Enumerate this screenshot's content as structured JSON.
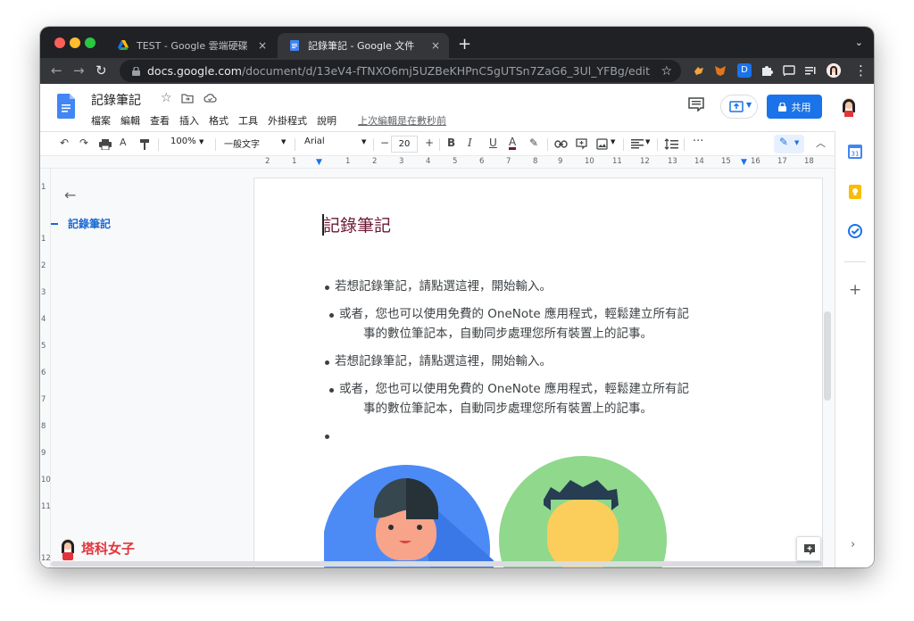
{
  "browser": {
    "tabs": [
      {
        "title": "TEST - Google 雲端硬碟",
        "close": "×"
      },
      {
        "title": "記錄筆記 - Google 文件",
        "close": "×"
      }
    ],
    "new_tab": "+",
    "tab_menu": "⌄",
    "url_host": "docs.google.com",
    "url_path": "/document/d/13eV4-fTNXO6mj5UZBeKHPnC5gUTSn7ZaG6_3Ul_YFBg/edit",
    "ext_d_label": "D"
  },
  "docs": {
    "title": "記錄筆記",
    "menu": [
      "檔案",
      "編輯",
      "查看",
      "插入",
      "格式",
      "工具",
      "外掛程式",
      "說明"
    ],
    "last_edit": "上次編輯是在數秒前",
    "share_label": "共用"
  },
  "toolbar": {
    "zoom": "100%",
    "style": "一般文字",
    "font": "Arial",
    "font_size": "20"
  },
  "ruler": {
    "h_ticks": [
      "2",
      "1",
      "1",
      "2",
      "3",
      "4",
      "5",
      "6",
      "7",
      "8",
      "9",
      "10",
      "11",
      "12",
      "13",
      "14",
      "15",
      "16",
      "17",
      "18"
    ],
    "v_ticks": [
      "1",
      "1",
      "2",
      "3",
      "4",
      "5",
      "6",
      "7",
      "8",
      "9",
      "10",
      "11",
      "12"
    ]
  },
  "outline": {
    "items": [
      "記錄筆記"
    ]
  },
  "document": {
    "heading": "記錄筆記",
    "bullets": [
      "若想記錄筆記，請點選這裡，開始輸入。",
      "或者，您也可以使用免費的 OneNote 應用程式，輕鬆建立所有記",
      "事的數位筆記本，自動同步處理您所有裝置上的記事。",
      "若想記錄筆記，請點選這裡，開始輸入。",
      "或者，您也可以使用免費的 OneNote 應用程式，輕鬆建立所有記",
      "事的數位筆記本，自動同步處理您所有裝置上的記事。"
    ]
  },
  "watermark": "塔科女子",
  "colors": {
    "title_color": "#6d1a35",
    "accent": "#1a73e8",
    "chrome_dark": "#202124",
    "watermark": "#e3343b"
  }
}
